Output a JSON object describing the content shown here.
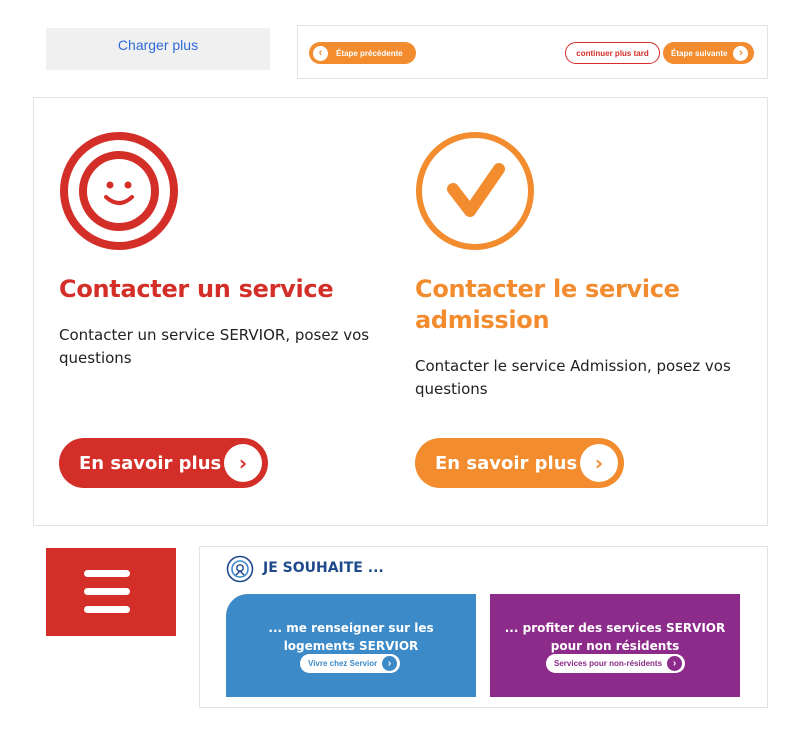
{
  "load_more": {
    "label": "Charger plus"
  },
  "step_nav": {
    "previous_label": "Étape précédente",
    "later_label": "continuer plus tard",
    "next_label": "Étape suivante",
    "prev_arrow": "‹",
    "next_arrow": "›"
  },
  "cards": [
    {
      "icon": "smiley-icon",
      "title": "Contacter un service",
      "description": "Contacter un service SERVIOR, posez vos questions",
      "button_label": "En savoir plus",
      "button_arrow": "›",
      "color": "#d42e28"
    },
    {
      "icon": "checkmark-icon",
      "title": "Contacter le service admission",
      "description": "Contacter le service Admission, posez vos questions",
      "button_label": "En savoir plus",
      "button_arrow": "›",
      "color": "#f28c2f"
    }
  ],
  "menu": {
    "icon": "hamburger-menu-icon",
    "color": "#d42e28"
  },
  "wishes": {
    "title": "JE SOUHAITE ...",
    "items": [
      {
        "text": "... me renseigner sur les logements SERVIOR",
        "button_label": "Vivre chez Servior",
        "arrow": "›",
        "color": "#3d8ac8"
      },
      {
        "text": "... profiter des services SERVIOR pour non résidents",
        "button_label": "Services pour non-résidents",
        "arrow": "›",
        "color": "#8c2b8a"
      }
    ]
  }
}
